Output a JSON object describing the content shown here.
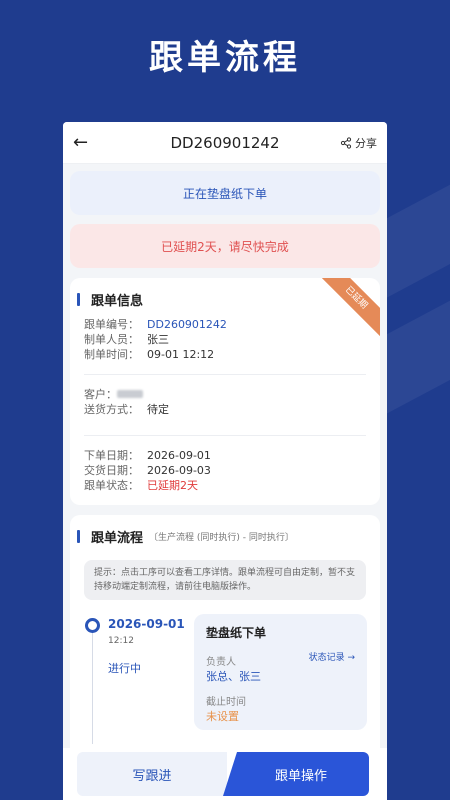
{
  "hero_title": "跟单流程",
  "nav": {
    "back_icon": "←",
    "title": "DD260901242",
    "share_label": "分享"
  },
  "banners": {
    "status": "正在垫盘纸下单",
    "overdue": "已延期2天，请尽快完成"
  },
  "info": {
    "section_title": "跟单信息",
    "ribbon": "已延期",
    "order_no_label": "跟单编号：",
    "order_no": "DD260901242",
    "creator_label": "制单人员：",
    "creator": "张三",
    "created_label": "制单时间：",
    "created": "09-01 12:12",
    "customer_label": "客户：",
    "delivery_label": "送货方式：",
    "delivery": "待定",
    "order_date_label": "下单日期：",
    "order_date": "2026-09-01",
    "due_date_label": "交货日期：",
    "due_date": "2026-09-03",
    "state_label": "跟单状态：",
    "state": "已延期2天"
  },
  "flow": {
    "section_title": "跟单流程",
    "section_sub": "〔生产流程 (同时执行) - 同时执行〕",
    "tip": "提示：点击工序可以查看工序详情。跟单流程可自由定制，暂不支持移动端定制流程，请前往电脑版操作。",
    "date": "2026-09-01",
    "time": "12:12",
    "status": "进行中",
    "task_name": "垫盘纸下单",
    "owner_label": "负责人",
    "owners": "张总、张三",
    "log_link": "状态记录 →",
    "deadline_label": "截止时间",
    "deadline": "未设置"
  },
  "buttons": {
    "follow": "写跟进",
    "operate": "跟单操作"
  },
  "colors": {
    "brand": "#1f3c8e",
    "accent": "#2a55b8",
    "danger": "#e05151",
    "warning": "#e8924a"
  }
}
